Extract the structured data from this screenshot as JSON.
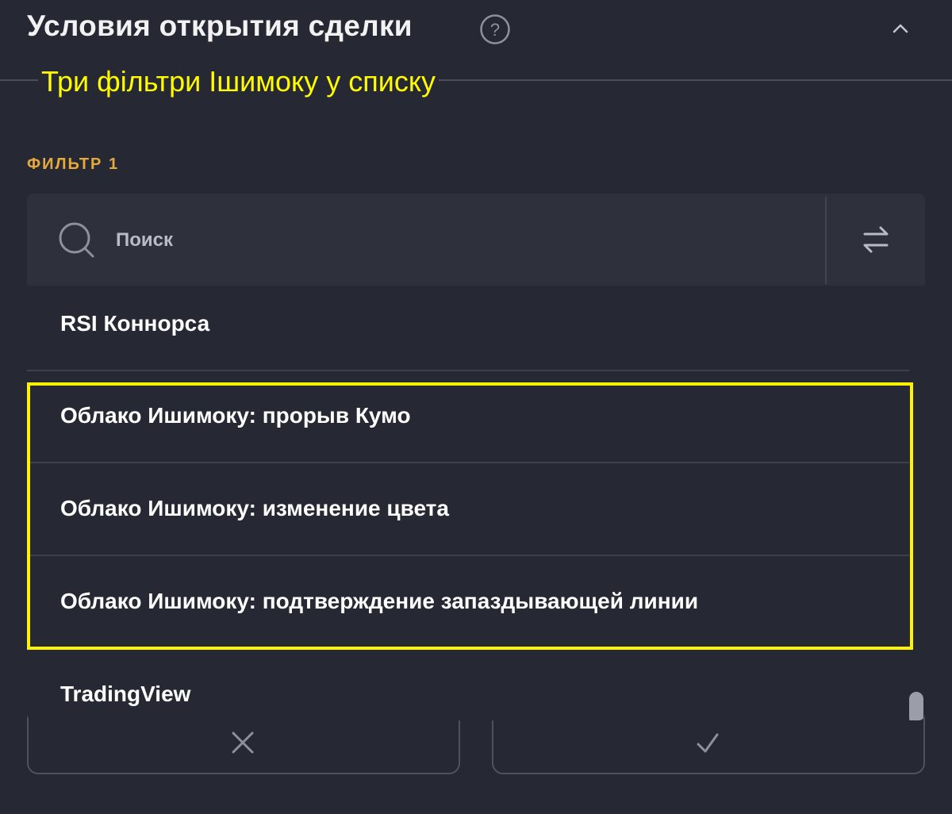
{
  "header": {
    "title": "Условия открытия сделки",
    "help_icon": "question-circle-icon",
    "collapse_icon": "chevron-up-icon"
  },
  "annotation": {
    "text": "Три фільтри Ішимоку у списку",
    "color": "#fffc00"
  },
  "filter": {
    "label": "ФИЛЬТР 1",
    "label_color": "#e6a93b"
  },
  "search": {
    "placeholder": "Поиск",
    "value": "",
    "search_icon": "search-icon",
    "sort_icon": "swap-arrows-icon"
  },
  "list": {
    "items": [
      {
        "label": "RSI Коннорса"
      },
      {
        "label": "Облако Ишимоку: прорыв Кумо"
      },
      {
        "label": "Облако Ишимоку: изменение цвета"
      },
      {
        "label": "Облако Ишимоку: подтверждение запаздывающей линии"
      },
      {
        "label": "TradingView"
      }
    ],
    "highlighted_items": [
      1,
      2,
      3
    ],
    "highlight_color": "#fff200"
  },
  "buttons": {
    "cancel_icon": "close-icon",
    "confirm_icon": "check-icon"
  },
  "colors": {
    "background": "#262833",
    "search_background": "#2e313c",
    "text": "#ffffff",
    "divider": "#3d404b"
  }
}
